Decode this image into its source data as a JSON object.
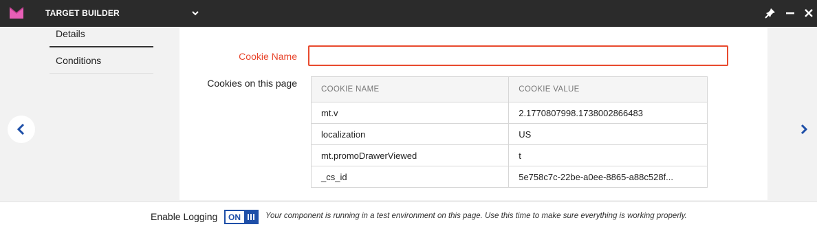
{
  "window": {
    "title": "TARGET BUILDER",
    "logo_icon": "m-logo-icon",
    "dropdown_icon": "chevron-down-icon",
    "controls": [
      "pin-icon",
      "minimize-icon",
      "close-icon"
    ]
  },
  "tabs": {
    "details": "Details",
    "conditions": "Conditions"
  },
  "form": {
    "cookie_name_label": "Cookie Name",
    "cookie_name_value": "",
    "cookies_label": "Cookies on this page"
  },
  "table": {
    "headers": [
      "COOKIE NAME",
      "COOKIE VALUE"
    ],
    "rows": [
      {
        "name": "mt.v",
        "value": "2.1770807998.1738002866483"
      },
      {
        "name": "localization",
        "value": "US"
      },
      {
        "name": "mt.promoDrawerViewed",
        "value": "t"
      },
      {
        "name": "_cs_id",
        "value": "5e758c7c-22be-a0ee-8865-a88c528f..."
      }
    ]
  },
  "nav": {
    "prev_icon": "chevron-left-icon",
    "next_icon": "chevron-right-icon"
  },
  "footer": {
    "logging_label": "Enable Logging",
    "toggle_label": "ON",
    "message": "Your component is running in a test environment on this page. Use this time to make sure everything is working properly."
  },
  "colors": {
    "topbar": "#2b2b2b",
    "logo": "#e85fb7",
    "accent_error": "#e84a2e",
    "toggle": "#1e4fa8"
  }
}
